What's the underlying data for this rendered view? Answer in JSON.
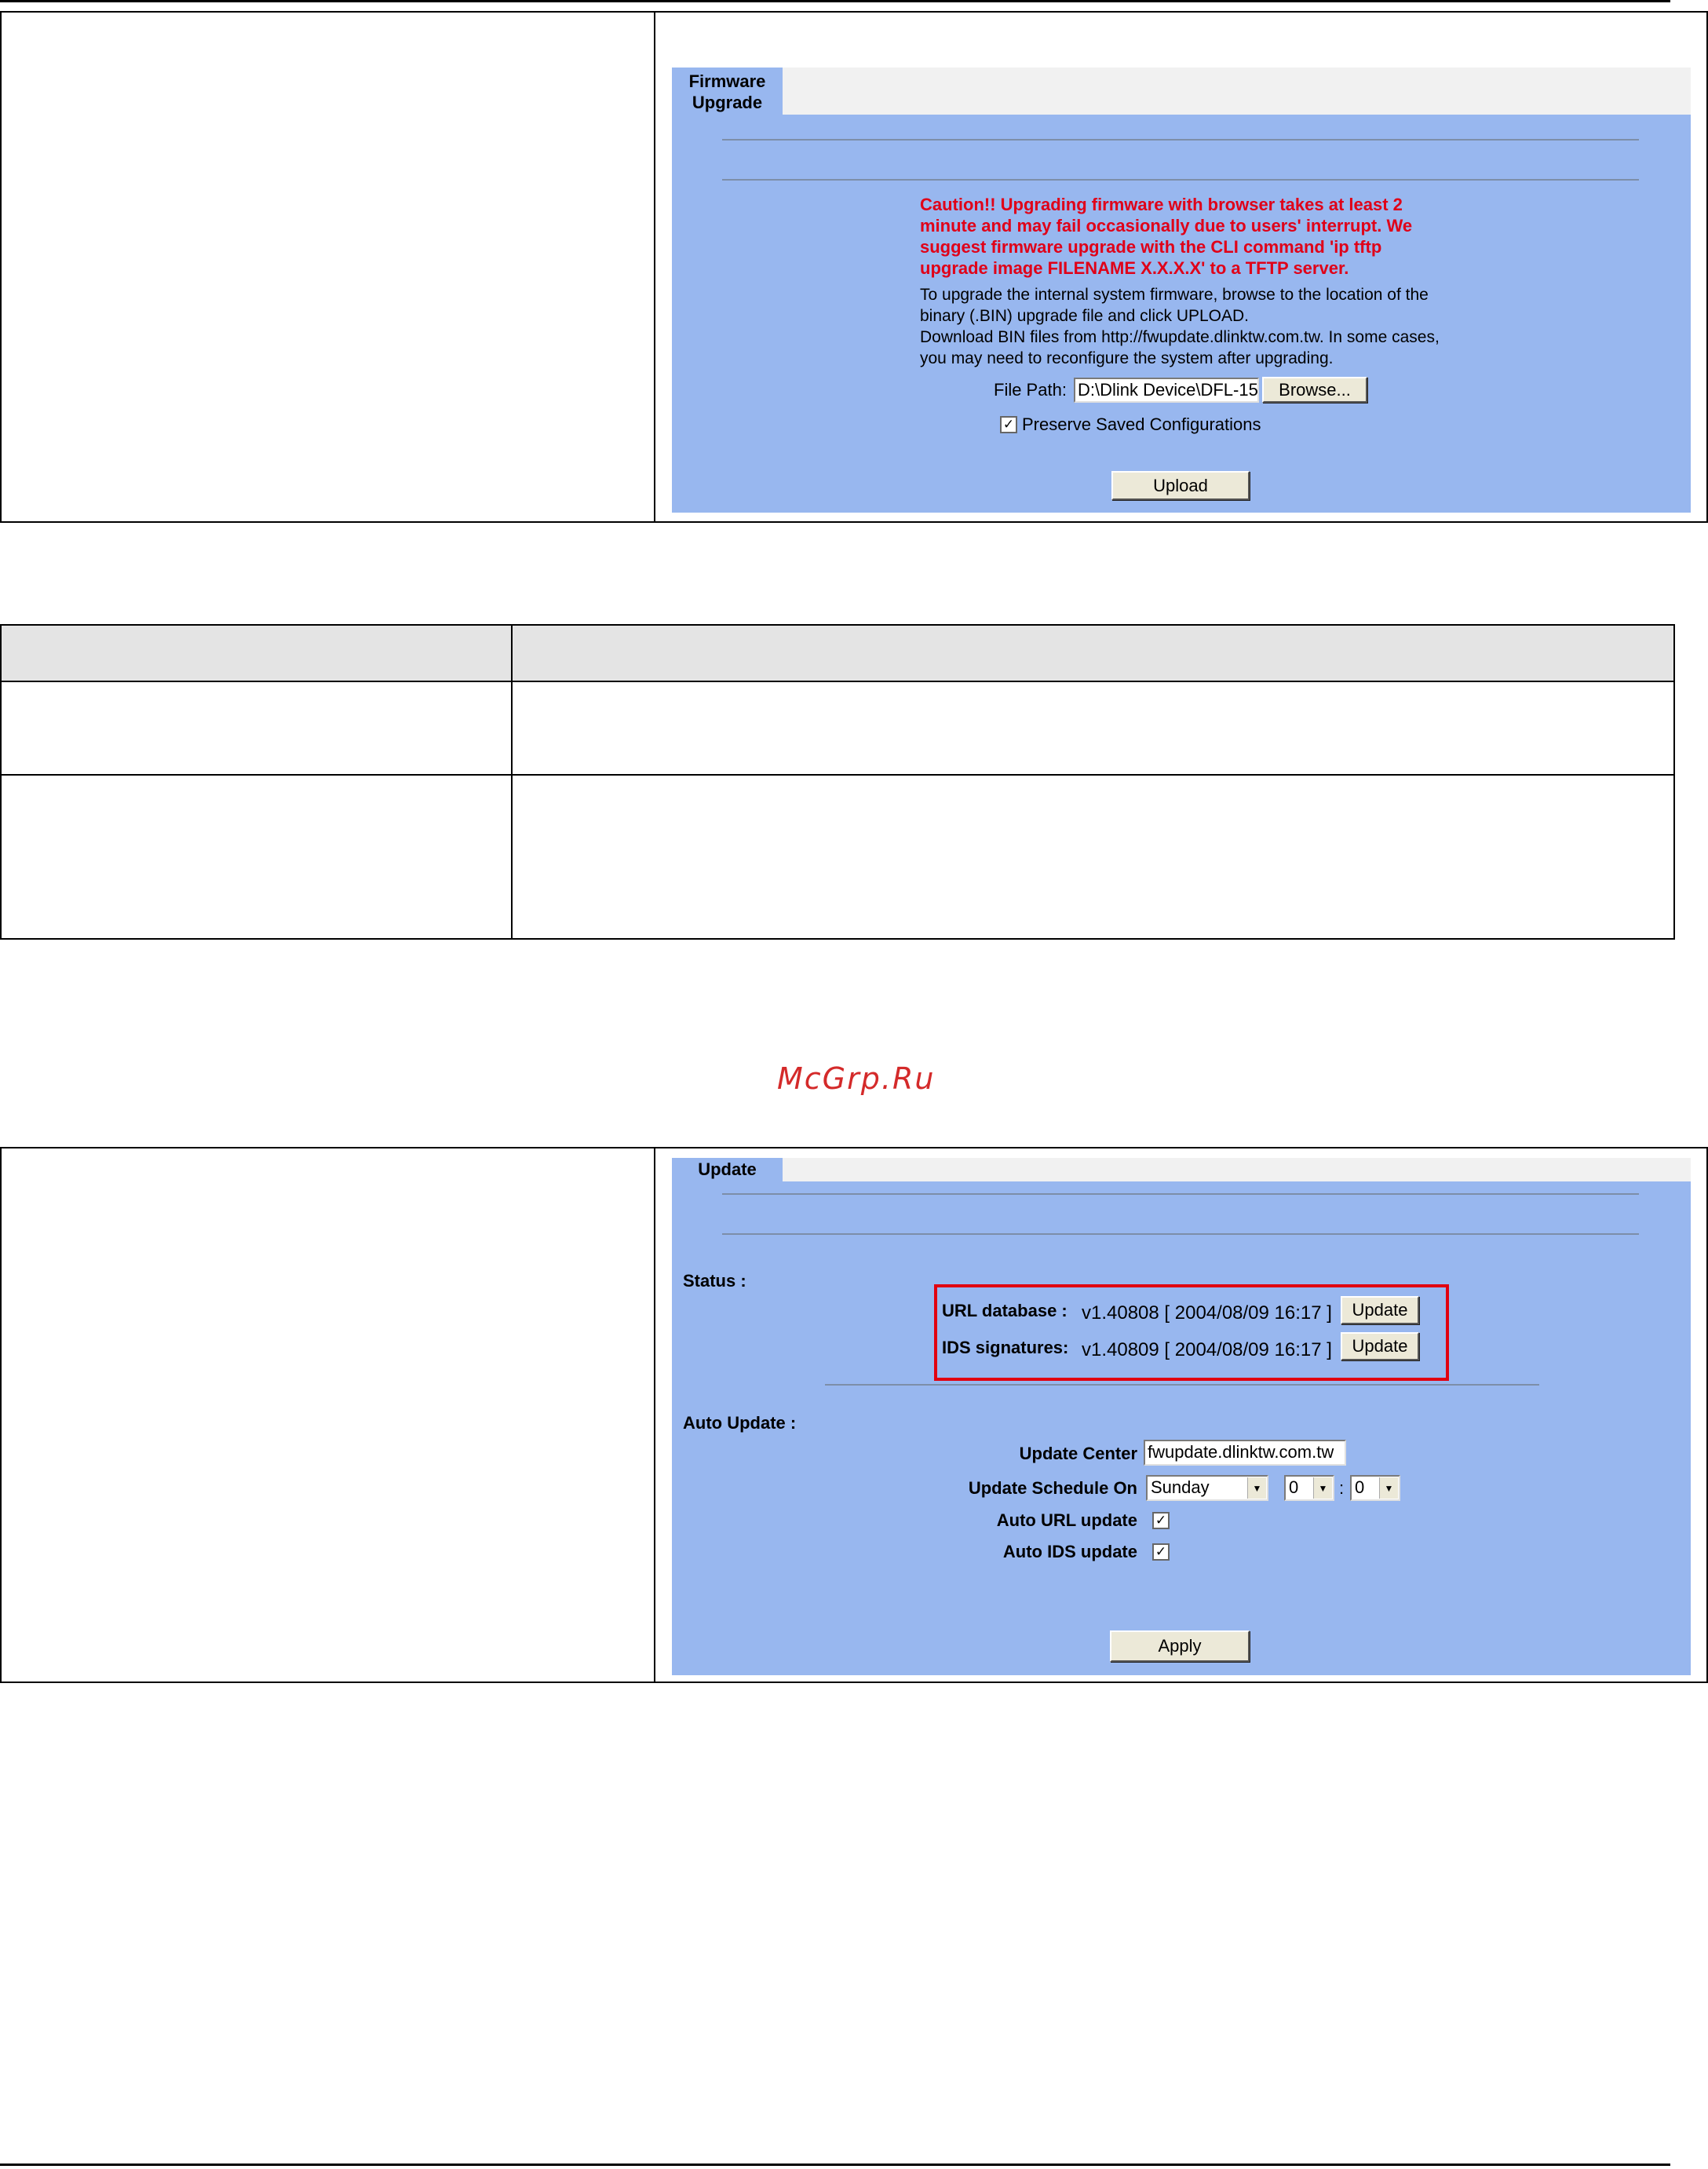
{
  "firmware_panel": {
    "tab_label_line1": "Firmware",
    "tab_label_line2": "Upgrade",
    "caution_text": "Caution!! Upgrading firmware with browser takes at least 2 minute and may fail occasionally due to users' interrupt. We suggest firmware upgrade with the CLI command 'ip tftp upgrade image FILENAME X.X.X.X' to a TFTP server.",
    "instructions_line1": "To upgrade the internal system firmware, browse to the location of the binary (.BIN) upgrade file and click UPLOAD.",
    "instructions_line2": "Download BIN files from http://fwupdate.dlinktw.com.tw. In some cases, you may need to reconfigure the system after upgrading.",
    "file_path_label": "File Path:",
    "file_path_value": "D:\\Dlink Device\\DFL-15",
    "browse_label": "Browse...",
    "preserve_label": "Preserve Saved Configurations",
    "preserve_checked": true,
    "upload_label": "Upload"
  },
  "watermark": "McGrp.Ru",
  "update_panel": {
    "tab_label": "Update",
    "status_label": "Status :",
    "url_db_label": "URL database :",
    "url_db_value": "v1.40808 [ 2004/08/09 16:17 ]",
    "ids_label": "IDS signatures:",
    "ids_value": "v1.40809 [ 2004/08/09 16:17 ]",
    "update_button_label": "Update",
    "auto_update_label": "Auto Update :",
    "update_center_label": "Update Center",
    "update_center_value": "fwupdate.dlinktw.com.tw",
    "schedule_label": "Update Schedule On",
    "schedule_day": "Sunday",
    "schedule_hour": "0",
    "schedule_sep": ":",
    "schedule_minute": "0",
    "auto_url_label": "Auto URL update",
    "auto_ids_label": "Auto IDS update",
    "checkmark": "✓",
    "apply_label": "Apply",
    "highlight_color": "#e10010",
    "panel_color": "#98b7ef"
  }
}
